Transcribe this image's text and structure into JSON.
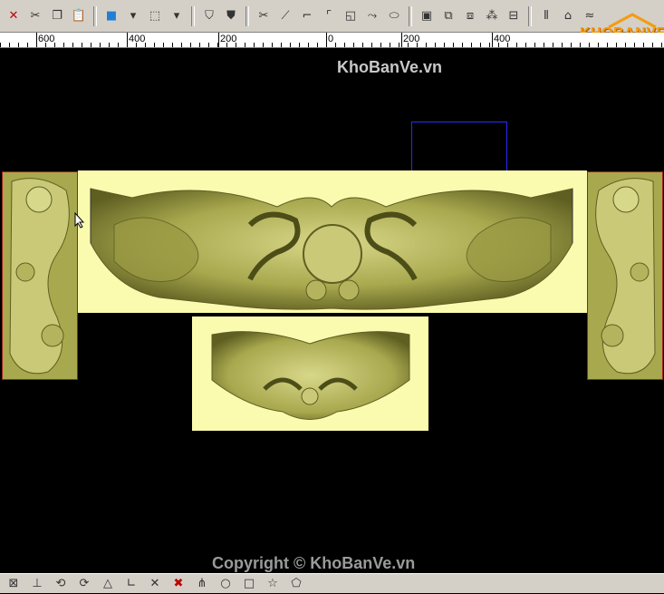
{
  "toolbar": {
    "buttons": [
      {
        "name": "delete-icon",
        "glyph": "✕"
      },
      {
        "name": "cut-icon",
        "glyph": "✂"
      },
      {
        "name": "copy-icon",
        "glyph": "❐"
      },
      {
        "name": "paste-icon",
        "glyph": "📋"
      },
      {
        "name": "color-cube-icon",
        "glyph": "■"
      },
      {
        "name": "dropdown-arrow-icon",
        "glyph": "▾"
      },
      {
        "name": "box-view-icon",
        "glyph": "⬚"
      },
      {
        "name": "dropdown-arrow-icon",
        "glyph": "▾"
      },
      {
        "name": "shield-icon",
        "glyph": "⛉"
      },
      {
        "name": "shield-filled-icon",
        "glyph": "⛊"
      },
      {
        "name": "scissors-icon",
        "glyph": "✂"
      },
      {
        "name": "trim-icon",
        "glyph": "⟋"
      },
      {
        "name": "corner-icon",
        "glyph": "⌐"
      },
      {
        "name": "corner-fillet-icon",
        "glyph": "⌜"
      },
      {
        "name": "offset-icon",
        "glyph": "◱"
      },
      {
        "name": "curve-icon",
        "glyph": "⤳"
      },
      {
        "name": "ellipse-icon",
        "glyph": "⬭"
      },
      {
        "name": "frame-icon",
        "glyph": "▣"
      },
      {
        "name": "group-icon",
        "glyph": "⧉"
      },
      {
        "name": "ungroup-icon",
        "glyph": "⧈"
      },
      {
        "name": "nodes-icon",
        "glyph": "⁂"
      },
      {
        "name": "align-icon",
        "glyph": "⊟"
      },
      {
        "name": "mirror-icon",
        "glyph": "⫴"
      },
      {
        "name": "home-icon",
        "glyph": "⌂"
      },
      {
        "name": "wave-icon",
        "glyph": "≈"
      }
    ]
  },
  "ruler": {
    "labels": [
      "600",
      "400",
      "200",
      "0",
      "200",
      "400"
    ]
  },
  "logo": {
    "text": "KHOBANVE"
  },
  "watermarks": {
    "top": "KhoBanVe.vn",
    "bottom": "Copyright © KhoBanVe.vn"
  },
  "colors": {
    "panel": "#fbfbb0",
    "carving": "#a8a84e",
    "carving_dark": "#5f5f22",
    "selection": "#2b2bff",
    "panel_border": "#a02020"
  },
  "statusbar": {
    "buttons": [
      {
        "name": "snap-icon",
        "glyph": "⊠"
      },
      {
        "name": "dimension-icon",
        "glyph": "⊥"
      },
      {
        "name": "rotate-icon",
        "glyph": "⟲"
      },
      {
        "name": "rotate-alt-icon",
        "glyph": "⟳"
      },
      {
        "name": "triangle-icon",
        "glyph": "△"
      },
      {
        "name": "line-icon",
        "glyph": "∟"
      },
      {
        "name": "cross-icon",
        "glyph": "✕"
      },
      {
        "name": "cross-red-icon",
        "glyph": "✖"
      },
      {
        "name": "node-edit-icon",
        "glyph": "⋔"
      },
      {
        "name": "circle-icon",
        "glyph": "○"
      },
      {
        "name": "square-icon",
        "glyph": "□"
      },
      {
        "name": "star-icon",
        "glyph": "☆"
      },
      {
        "name": "polygon-icon",
        "glyph": "⬠"
      }
    ]
  }
}
